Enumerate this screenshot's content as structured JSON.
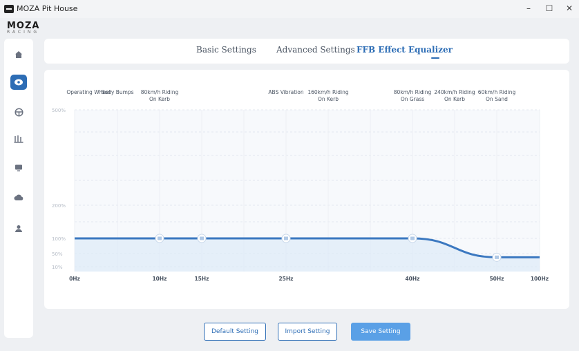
{
  "window": {
    "title": "MOZA Pit House",
    "minimize_glyph": "–",
    "maximize_glyph": "☐",
    "close_glyph": "✕"
  },
  "brand": {
    "main": "MOZA",
    "sub": "RACING"
  },
  "sidebar": {
    "items": [
      {
        "icon": "home-icon",
        "active": false
      },
      {
        "icon": "wheelbase-icon",
        "active": true
      },
      {
        "icon": "steering-wheel-icon",
        "active": false
      },
      {
        "icon": "pedals-icon",
        "active": false
      },
      {
        "icon": "dashboard-icon",
        "active": false
      },
      {
        "icon": "cloud-icon",
        "active": false
      },
      {
        "icon": "user-icon",
        "active": false
      }
    ]
  },
  "tabs": [
    {
      "label": "Basic Settings",
      "active": false
    },
    {
      "label": "Advanced Settings",
      "active": false
    },
    {
      "label": "FFB Effect Equalizer",
      "active": true
    }
  ],
  "chart_data": {
    "type": "line",
    "column_labels": [
      [
        "Operating Wheel"
      ],
      [
        "Body Bumps"
      ],
      [
        "80km/h Riding",
        "On Kerb"
      ],
      [
        ""
      ],
      [
        ""
      ],
      [
        "ABS Vibration"
      ],
      [
        "160km/h Riding",
        "On Kerb"
      ],
      [
        ""
      ],
      [
        "80km/h Riding",
        "On Grass"
      ],
      [
        "240km/h Riding",
        "On Kerb"
      ],
      [
        "60km/h Riding",
        "On Sand"
      ]
    ],
    "y_tick_labels": [
      "500%",
      "200%",
      "100%",
      "50%",
      "10%"
    ],
    "x_tick_labels": [
      {
        "label": "0Hz",
        "column": 0
      },
      {
        "label": "10Hz",
        "column": 2
      },
      {
        "label": "15Hz",
        "column": 3
      },
      {
        "label": "25Hz",
        "column": 5
      },
      {
        "label": "40Hz",
        "column": 8
      },
      {
        "label": "50Hz",
        "column": 10
      },
      {
        "label": "100Hz",
        "column": 11
      }
    ],
    "series": [
      {
        "points": [
          {
            "column": 0,
            "value": 100
          },
          {
            "column": 2,
            "value": 100
          },
          {
            "column": 3,
            "value": 100
          },
          {
            "column": 5,
            "value": 100
          },
          {
            "column": 8,
            "value": 100
          },
          {
            "column": 10,
            "value": 40
          },
          {
            "column": 11,
            "value": 40
          }
        ]
      }
    ],
    "handles": [
      {
        "column": 2,
        "value": 100
      },
      {
        "column": 3,
        "value": 100
      },
      {
        "column": 5,
        "value": 100
      },
      {
        "column": 8,
        "value": 100
      },
      {
        "column": 10,
        "value": 40
      }
    ],
    "line_color": "#3b78c0"
  },
  "buttons": {
    "default_label": "Default Setting",
    "import_label": "Import Setting",
    "save_label": "Save Setting"
  },
  "colors": {
    "accent": "#2d6db5",
    "primary_button": "#5aa0e6"
  }
}
